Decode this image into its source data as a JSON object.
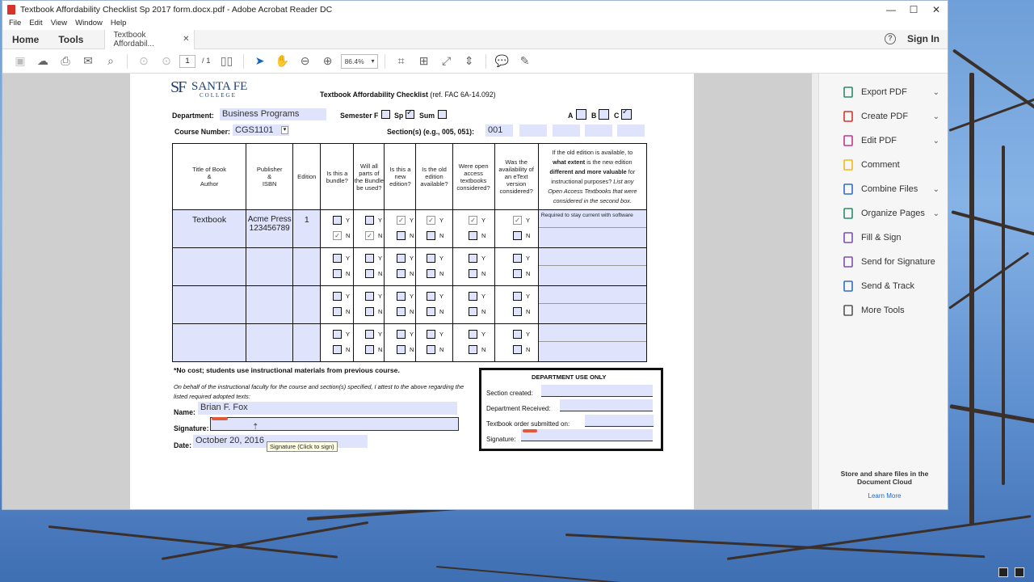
{
  "window": {
    "title": "Textbook Affordability Checklist Sp 2017 form.docx.pdf - Adobe Acrobat Reader DC",
    "controls": [
      "—",
      "☐",
      "✕"
    ]
  },
  "menu": [
    "File",
    "Edit",
    "View",
    "Window",
    "Help"
  ],
  "tabs": {
    "home": "Home",
    "tools": "Tools",
    "document": "Textbook Affordabil...",
    "close": "✕",
    "help": "?",
    "sign_in": "Sign In"
  },
  "toolbar": {
    "page_current": "1",
    "page_total": "/ 1",
    "zoom": "86.4%"
  },
  "right_panel": {
    "tools": [
      {
        "label": "Export PDF",
        "icon": "export-pdf-icon",
        "color": "#2b8a6e",
        "chevron": true
      },
      {
        "label": "Create PDF",
        "icon": "create-pdf-icon",
        "color": "#d8332b",
        "chevron": true
      },
      {
        "label": "Edit PDF",
        "icon": "edit-pdf-icon",
        "color": "#c2378e",
        "chevron": true
      },
      {
        "label": "Comment",
        "icon": "comment-icon",
        "color": "#f2b81a",
        "chevron": false
      },
      {
        "label": "Combine Files",
        "icon": "combine-files-icon",
        "color": "#2f6fc7",
        "chevron": true
      },
      {
        "label": "Organize Pages",
        "icon": "organize-pages-icon",
        "color": "#2b8a6e",
        "chevron": true
      },
      {
        "label": "Fill & Sign",
        "icon": "fill-sign-icon",
        "color": "#7b4fb3",
        "chevron": false
      },
      {
        "label": "Send for Signature",
        "icon": "send-signature-icon",
        "color": "#7b4fb3",
        "chevron": false
      },
      {
        "label": "Send & Track",
        "icon": "send-track-icon",
        "color": "#2f6fc7",
        "chevron": false
      },
      {
        "label": "More Tools",
        "icon": "more-tools-icon",
        "color": "#555555",
        "chevron": false
      }
    ],
    "cloud_text": "Store and share files in the Document Cloud",
    "learn_more": "Learn More"
  },
  "form": {
    "logo_sf": "SF",
    "logo_name": "SANTA FE",
    "logo_college": "COLLEGE",
    "title": "Textbook Affordability Checklist",
    "title_ref": "(ref. FAC 6A-14.092)",
    "department_label": "Department:",
    "department_value": "Business Programs",
    "semester_label": "Semester F",
    "sp_label": "Sp",
    "sum_label": "Sum",
    "a_label": "A",
    "b_label": "B",
    "c_label": "C",
    "course_label": "Course Number:",
    "course_value": "CGS1101",
    "sections_label": "Section(s) (e.g., 005, 051):",
    "sections_value": "001",
    "headers": [
      "Title of Book\n&\nAuthor",
      "Publisher\n&\nISBN",
      "Edition",
      "Is this a bundle?",
      "Will all parts of the Bundle be used?",
      "Is this a new edition?",
      "Is the old edition available?",
      "Were open access textbooks considered?",
      "Was the availability of an eText version considered?"
    ],
    "last_header_line1": "If the old edition is available, to",
    "last_header_line2a": "what extent",
    "last_header_line2b": " is the new edition",
    "last_header_line3": "different and more valuable",
    "last_header_line3b": " for",
    "last_header_line4": "instructional purposes? ",
    "last_header_line4b": "List any",
    "last_header_line5": "Open Access Textbooks that were considered in the second box.",
    "row1_title": "Textbook",
    "row1_publisher": "Acme Press 123456789",
    "row1_edition": "1",
    "row1_note": "Required to stay current with software",
    "yes": "Y",
    "no": "N",
    "no_cost": "*No cost; students use instructional materials from previous course.",
    "attest": "On behalf of the instructional faculty for the course and section(s) specified, I attest to the above regarding the listed required adopted texts:",
    "name_label": "Name:",
    "name_value": "Brian F. Fox",
    "signature_label": "Signature:",
    "date_label": "Date:",
    "date_value": "October 20, 2016",
    "tooltip": "Signature (Click to sign)",
    "dept_title": "DEPARTMENT USE ONLY",
    "dept_fields": [
      "Section created:",
      "Department Received:",
      "Textbook order submitted on:",
      "Signature:"
    ]
  }
}
